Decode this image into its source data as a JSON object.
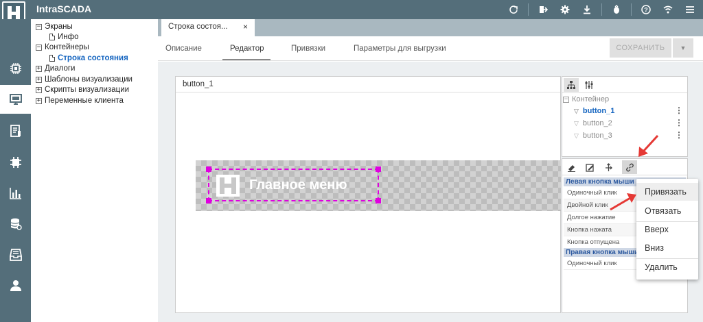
{
  "app": {
    "title": "IntraSCADA"
  },
  "topbar": {
    "icons": [
      "refresh-icon",
      "exit-app-icon",
      "gear-icon",
      "download-icon",
      "bug-icon",
      "help-icon",
      "wifi-icon",
      "menu-icon"
    ]
  },
  "rail": {
    "items": [
      "chip-icon",
      "monitor-icon",
      "report-icon",
      "module-icon",
      "chart-icon",
      "database-icon",
      "archive-icon",
      "user-icon"
    ],
    "active_index": 1
  },
  "tree": {
    "items": [
      {
        "label": "Экраны",
        "level": 0,
        "toggle": "−"
      },
      {
        "label": "Инфо",
        "level": 1
      },
      {
        "label": "Контейнеры",
        "level": 0,
        "toggle": "−"
      },
      {
        "label": "Строка состояния",
        "level": 1,
        "selected": true
      },
      {
        "label": "Диалоги",
        "level": 0,
        "toggle": "+"
      },
      {
        "label": "Шаблоны визуализации",
        "level": 0,
        "toggle": "+"
      },
      {
        "label": "Скрипты визуализации",
        "level": 0,
        "toggle": "+"
      },
      {
        "label": "Переменные клиента",
        "level": 0,
        "toggle": "+"
      }
    ]
  },
  "doc_tab": {
    "label": "Строка состоя...",
    "close": "×"
  },
  "subtabs": [
    "Описание",
    "Редактор",
    "Привязки",
    "Параметры для выгрузки"
  ],
  "save": {
    "label": "СОХРАНИТЬ",
    "dropdown": "▼"
  },
  "canvas": {
    "title": "button_1",
    "button_label": "Главное меню"
  },
  "component_tree": {
    "root": "Контейнер",
    "root_toggle": "−",
    "items": [
      "button_1",
      "button_2",
      "button_3"
    ],
    "kebab": "⋮"
  },
  "events": {
    "left_header": "Левая кнопка мыши",
    "left_rows": [
      "Одиночный клик",
      "Двойной клик",
      "Долгое нажатие",
      "Кнопка нажата",
      "Кнопка отпущена"
    ],
    "right_header": "Правая кнопка мыши",
    "right_rows": [
      "Одиночный клик"
    ]
  },
  "context_menu": {
    "items": [
      "Привязать",
      "Отвязать",
      "Вверх",
      "Вниз",
      "Удалить"
    ]
  },
  "colors": {
    "topbar": "#546e7a",
    "accent": "#1565c0",
    "selection": "#e000e0",
    "arrow": "#e53935"
  }
}
